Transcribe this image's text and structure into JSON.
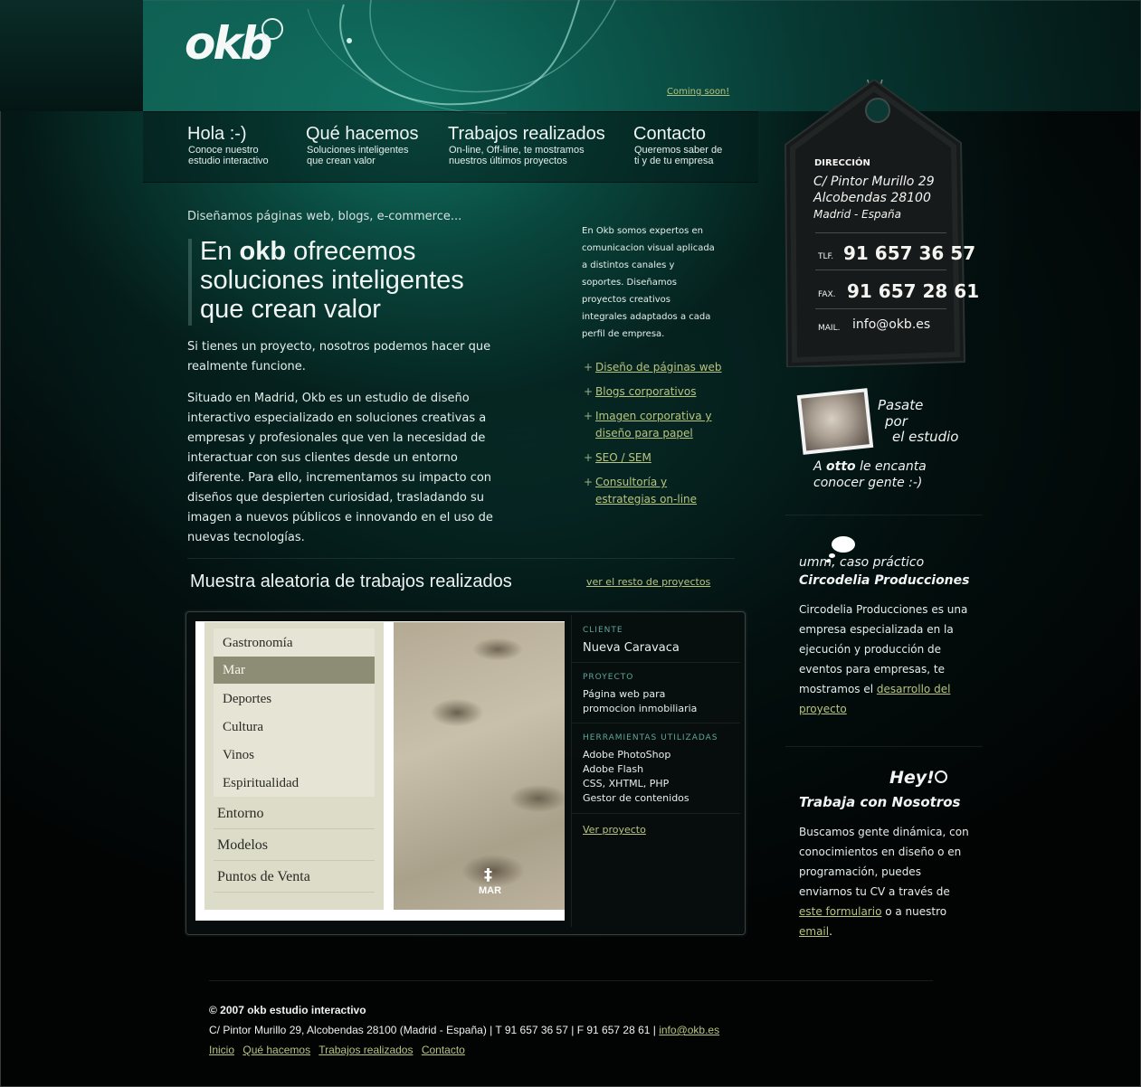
{
  "brand": {
    "logo": "okb",
    "coming_soon": "Coming soon!"
  },
  "nav": [
    {
      "title": "Hola :-)",
      "sub": "Conoce nuestro estudio interactivo"
    },
    {
      "title": "Qué hacemos",
      "sub": "Soluciones inteligentes que crean valor"
    },
    {
      "title": "Trabajos realizados",
      "sub": "On-line, Off-line, te mostramos nuestros últimos proyectos"
    },
    {
      "title": "Contacto",
      "sub": "Queremos saber de ti y de tu empresa"
    }
  ],
  "intro": {
    "kicker": "Diseñamos páginas web, blogs, e-commerce...",
    "headline_pre": "En ",
    "headline_brand": "okb",
    "headline_post": " ofrecemos soluciones inteligentes que crean valor",
    "p1": "Si tienes un proyecto, nosotros podemos hacer que realmente funcione.",
    "p2": "Situado en Madrid, Okb es un estudio de diseño interactivo especializado en soluciones creativas a empresas y profesionales que ven la necesidad de interactuar con sus clientes desde un entorno diferente. Para ello, incrementamos su impacto con diseños que despierten curiosidad, trasladando su imagen a nuevos públicos e innovando en el uso de nuevas tecnologías."
  },
  "aside": {
    "text": "En Okb somos expertos en comunicacion visual aplicada a distintos canales y soportes. Diseñamos proyectos creativos integrales adaptados a cada perfil de empresa.",
    "services": [
      "Diseño de páginas web",
      "Blogs corporativos",
      "Imagen corporativa y diseño para papel",
      "SEO / SEM",
      "Consultoría y estrategias on-line"
    ]
  },
  "portfolio": {
    "title": "Muestra aleatoria de trabajos realizados",
    "more_link": "ver el resto de proyectos",
    "menu_sub": [
      "Gastronomía",
      "Mar",
      "Deportes",
      "Cultura",
      "Vinos",
      "Espiritualidad"
    ],
    "menu_main": [
      "Entorno",
      "Modelos",
      "Puntos de Venta"
    ],
    "image_label": "MAR",
    "image_symbol": "‡",
    "client_label": "CLIENTE",
    "client": "Nueva Caravaca",
    "project_label": "PROYECTO",
    "project": "Página web para promocion inmobiliaria",
    "tools_label": "HERRAMIENTAS UTILIZADAS",
    "tools": [
      "Adobe PhotoShop",
      "Adobe Flash",
      "CSS, XHTML, PHP",
      "Gestor de contenidos"
    ],
    "view_link": "Ver proyecto"
  },
  "contact_tag": {
    "label_address": "DIRECCIÓN",
    "address_1": "C/ Pintor Murillo 29",
    "address_2": "Alcobendas 28100",
    "address_3": "Madrid - España",
    "tel_label": "TLF.",
    "tel": "91 657 36 57",
    "fax_label": "FAX.",
    "fax": "91 657 28 61",
    "mail_label": "MAIL.",
    "mail": "info@okb.es"
  },
  "visit": {
    "line1": "Pasate",
    "line2": "por",
    "line3": "el estudio",
    "otto_pre": "A ",
    "otto_name": "otto",
    "otto_post": " le encanta",
    "otto_line2": "conocer gente :-)"
  },
  "case_study": {
    "title_1": "umm, caso práctico",
    "title_2": "Circodelia Producciones",
    "text": "Circodelia Producciones es una empresa especializada en la ejecución y producción de eventos para empresas, te mostramos el ",
    "link": "desarrollo del proyecto"
  },
  "jobs": {
    "hey": "Hey!",
    "title": "Trabaja con Nosotros",
    "text_1": "Buscamos gente dinámica, con conocimientos en diseño o en programación, puedes enviarnos tu CV a través de ",
    "link_1": "este formulario",
    "text_2": " o a nuestro ",
    "link_2": "email",
    "text_3": "."
  },
  "footer": {
    "copyright": "© 2007 okb estudio interactivo",
    "address": "C/ Pintor Murillo 29, Alcobendas 28100 (Madrid - España) | T 91 657 36 57 | F 91 657 28 61 | ",
    "email": "info@okb.es",
    "links": [
      "Inicio",
      "Qué hacemos",
      "Trabajos realizados",
      "Contacto"
    ]
  }
}
